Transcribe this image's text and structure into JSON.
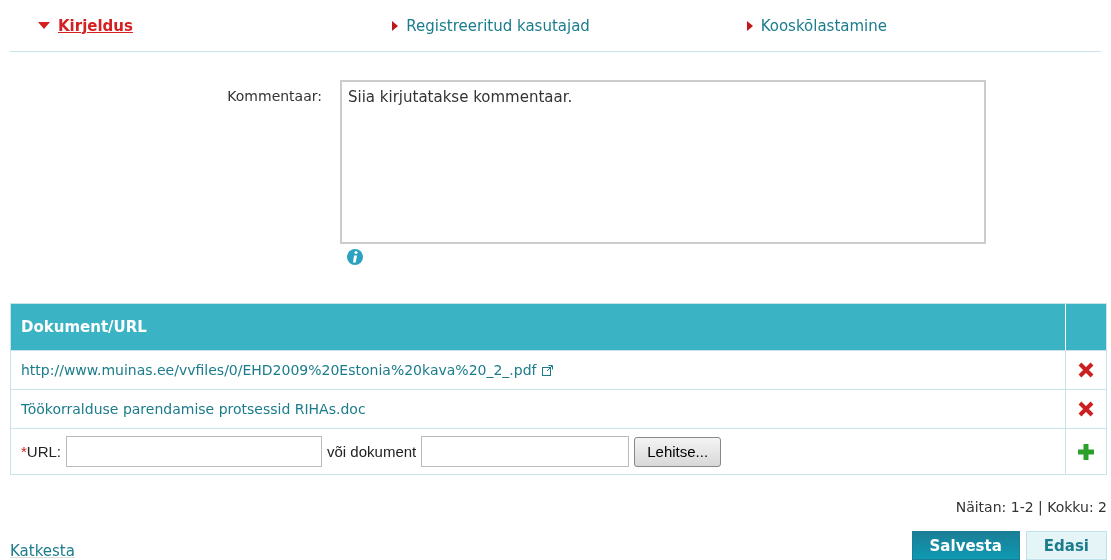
{
  "tabs": [
    {
      "label": "Kirjeldus",
      "selected": true
    },
    {
      "label": "Registreeritud kasutajad",
      "selected": false
    },
    {
      "label": "Kooskõlastamine",
      "selected": false
    }
  ],
  "comment": {
    "label": "Kommentaar:",
    "value": "Siia kirjutatakse kommentaar."
  },
  "table": {
    "columns": [
      "Dokument/URL"
    ],
    "rows": [
      {
        "text": "http://www.muinas.ee/vvfiles/0/EHD2009%20Estonia%20kava%20_2_.pdf",
        "external": true
      },
      {
        "text": "Töökorralduse parendamise protsessid RIHAs.doc",
        "external": false
      }
    ],
    "add_row": {
      "required_mark": "*",
      "url_label": "URL:",
      "document_label": "või dokument",
      "browse_button": "Lehitse..."
    }
  },
  "paging": "Näitan: 1-2 | Kokku: 2",
  "cancel_link": "Katkesta",
  "buttons": [
    {
      "label": "Salvesta",
      "kind": "primary"
    },
    {
      "label": "Edasi",
      "kind": "secondary"
    }
  ]
}
